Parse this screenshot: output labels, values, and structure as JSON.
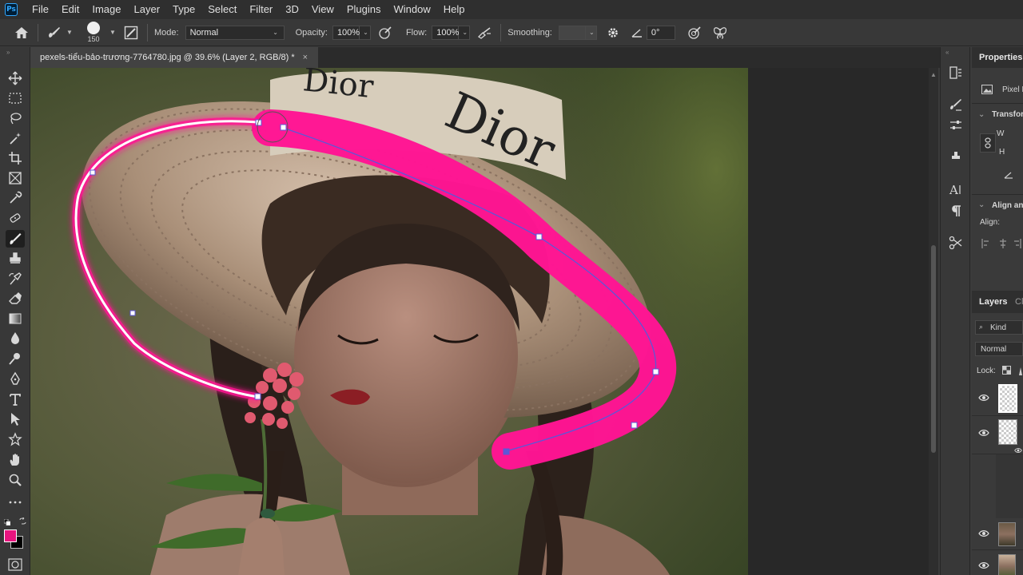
{
  "app": {
    "logo": "Ps"
  },
  "menu": [
    "File",
    "Edit",
    "Image",
    "Layer",
    "Type",
    "Select",
    "Filter",
    "3D",
    "View",
    "Plugins",
    "Window",
    "Help"
  ],
  "options": {
    "brush_size": "150",
    "mode_label": "Mode:",
    "mode_value": "Normal",
    "opacity_label": "Opacity:",
    "opacity_value": "100%",
    "flow_label": "Flow:",
    "flow_value": "100%",
    "smoothing_label": "Smoothing:",
    "smoothing_value": "",
    "angle_value": "0°"
  },
  "document": {
    "tab_title": "pexels-tiểu-bảo-trương-7764780.jpg @ 39.6% (Layer 2, RGB/8) *",
    "close_glyph": "×"
  },
  "hat_text": {
    "word_top": "Dior",
    "word_big": "Dior"
  },
  "colors": {
    "foreground": "#e8157f",
    "background": "#000000",
    "stroke": "#ff1493"
  },
  "panels": {
    "properties_tab": "Properties",
    "pixel_label": "Pixel L",
    "transform_label": "Transfor",
    "w_label": "W",
    "h_label": "H",
    "align_label": "Align an",
    "align_sub": "Align:",
    "layers_tab": "Layers",
    "channels_tab": "Cl",
    "kind_label": "Kind",
    "blend_mode": "Normal",
    "lock_label": "Lock:"
  }
}
